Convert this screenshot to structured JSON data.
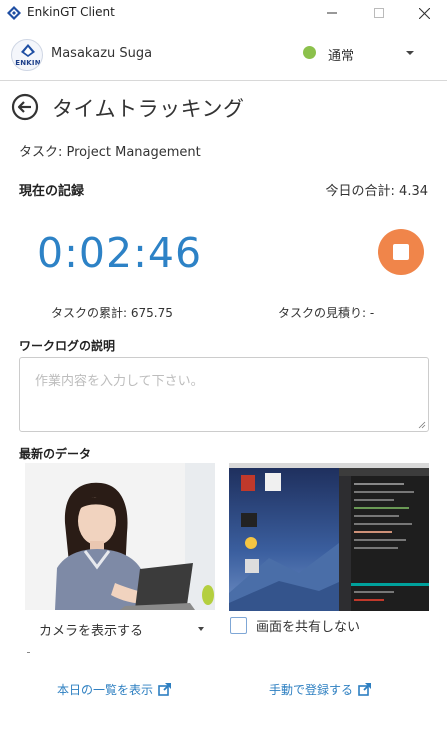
{
  "window": {
    "title": "EnkinGT Client"
  },
  "user": {
    "avatar_text": "ENKIN",
    "name": "Masakazu Suga",
    "status": "通常",
    "status_color": "#8cc14c"
  },
  "page": {
    "title": "タイムトラッキング",
    "task_line": "タスク: Project Management"
  },
  "record": {
    "current_label": "現在の記録",
    "today_total": "今日の合計: 4.34",
    "timer": "0:02:46",
    "task_total": "タスクの累計: 675.75",
    "task_estimate": "タスクの見積り: -"
  },
  "worklog": {
    "label": "ワークログの説明",
    "placeholder": "作業内容を入力して下さい。"
  },
  "latest": {
    "label": "最新のデータ",
    "camera_select": "カメラを表示する",
    "share_label": "画面を共有しない"
  },
  "links": {
    "today_list": "本日の一覧を表示",
    "manual_entry": "手動で登録する"
  },
  "colors": {
    "accent": "#2d82c6",
    "stop": "#f0854a",
    "link": "#2d7fc1"
  }
}
